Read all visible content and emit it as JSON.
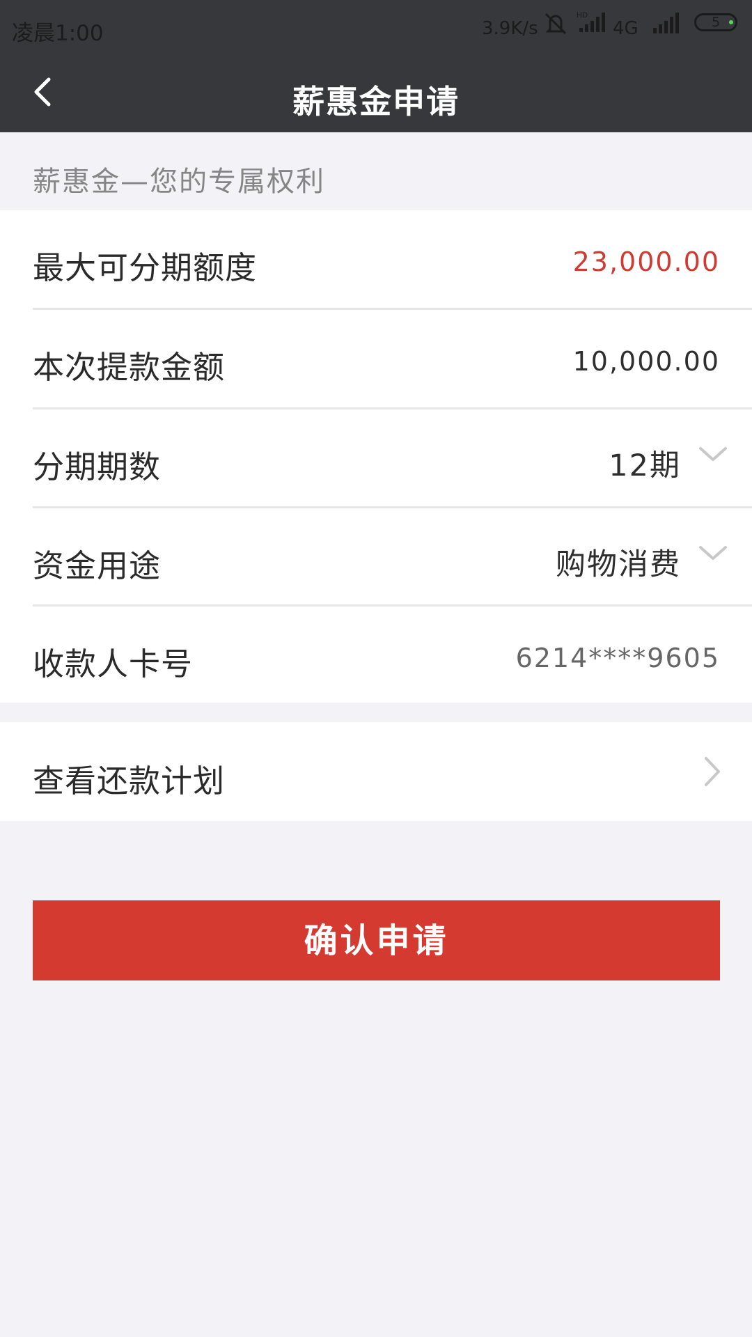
{
  "status_bar": {
    "time": "凌晨1:00",
    "network_speed": "3.9K/s",
    "network_type": "4G",
    "battery_level": "5",
    "icons": [
      "mute-icon",
      "hd-signal-icon",
      "signal-icon",
      "battery-icon"
    ]
  },
  "nav": {
    "title": "薪惠金申请",
    "back_icon": "chevron-left-icon"
  },
  "subtitle": "薪惠金—您的专属权利",
  "form": {
    "rows": [
      {
        "label": "最大可分期额度",
        "value": "23,000.00"
      },
      {
        "label": "本次提款金额",
        "value": "10,000.00"
      },
      {
        "label": "分期期数",
        "value": "12期"
      },
      {
        "label": "资金用途",
        "value": "购物消费"
      },
      {
        "label": "收款人卡号",
        "value": "6214****9605"
      }
    ]
  },
  "repayment_plan": {
    "label": "查看还款计划"
  },
  "confirm_button": {
    "label": "确认申请"
  },
  "colors": {
    "header_bg": "#37383c",
    "accent_red": "#d53a31",
    "page_bg": "#f3f3f7"
  }
}
